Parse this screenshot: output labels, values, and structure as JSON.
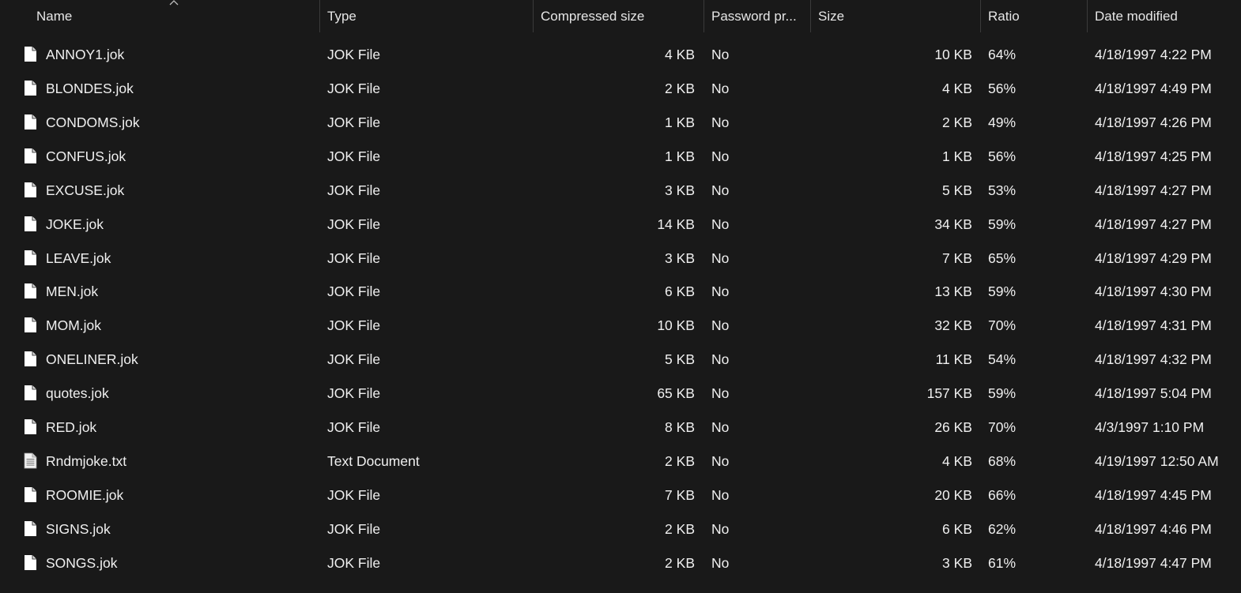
{
  "columns": {
    "name": "Name",
    "type": "Type",
    "compressed_size": "Compressed size",
    "password_protected": "Password pr...",
    "size": "Size",
    "ratio": "Ratio",
    "date_modified": "Date modified"
  },
  "sort": {
    "column": "Name",
    "direction": "ascending",
    "icon": "sort-ascending-caret-icon"
  },
  "rows": [
    {
      "icon": "document-icon",
      "name": "ANNOY1.jok",
      "type": "JOK File",
      "compressed": "4 KB",
      "password": "No",
      "size": "10 KB",
      "ratio": "64%",
      "date": "4/18/1997 4:22 PM"
    },
    {
      "icon": "document-icon",
      "name": "BLONDES.jok",
      "type": "JOK File",
      "compressed": "2 KB",
      "password": "No",
      "size": "4 KB",
      "ratio": "56%",
      "date": "4/18/1997 4:49 PM"
    },
    {
      "icon": "document-icon",
      "name": "CONDOMS.jok",
      "type": "JOK File",
      "compressed": "1 KB",
      "password": "No",
      "size": "2 KB",
      "ratio": "49%",
      "date": "4/18/1997 4:26 PM"
    },
    {
      "icon": "document-icon",
      "name": "CONFUS.jok",
      "type": "JOK File",
      "compressed": "1 KB",
      "password": "No",
      "size": "1 KB",
      "ratio": "56%",
      "date": "4/18/1997 4:25 PM"
    },
    {
      "icon": "document-icon",
      "name": "EXCUSE.jok",
      "type": "JOK File",
      "compressed": "3 KB",
      "password": "No",
      "size": "5 KB",
      "ratio": "53%",
      "date": "4/18/1997 4:27 PM"
    },
    {
      "icon": "document-icon",
      "name": "JOKE.jok",
      "type": "JOK File",
      "compressed": "14 KB",
      "password": "No",
      "size": "34 KB",
      "ratio": "59%",
      "date": "4/18/1997 4:27 PM"
    },
    {
      "icon": "document-icon",
      "name": "LEAVE.jok",
      "type": "JOK File",
      "compressed": "3 KB",
      "password": "No",
      "size": "7 KB",
      "ratio": "65%",
      "date": "4/18/1997 4:29 PM"
    },
    {
      "icon": "document-icon",
      "name": "MEN.jok",
      "type": "JOK File",
      "compressed": "6 KB",
      "password": "No",
      "size": "13 KB",
      "ratio": "59%",
      "date": "4/18/1997 4:30 PM"
    },
    {
      "icon": "document-icon",
      "name": "MOM.jok",
      "type": "JOK File",
      "compressed": "10 KB",
      "password": "No",
      "size": "32 KB",
      "ratio": "70%",
      "date": "4/18/1997 4:31 PM"
    },
    {
      "icon": "document-icon",
      "name": "ONELINER.jok",
      "type": "JOK File",
      "compressed": "5 KB",
      "password": "No",
      "size": "11 KB",
      "ratio": "54%",
      "date": "4/18/1997 4:32 PM"
    },
    {
      "icon": "document-icon",
      "name": "quotes.jok",
      "type": "JOK File",
      "compressed": "65 KB",
      "password": "No",
      "size": "157 KB",
      "ratio": "59%",
      "date": "4/18/1997 5:04 PM"
    },
    {
      "icon": "document-icon",
      "name": "RED.jok",
      "type": "JOK File",
      "compressed": "8 KB",
      "password": "No",
      "size": "26 KB",
      "ratio": "70%",
      "date": "4/3/1997 1:10 PM"
    },
    {
      "icon": "text-document-icon",
      "name": "Rndmjoke.txt",
      "type": "Text Document",
      "compressed": "2 KB",
      "password": "No",
      "size": "4 KB",
      "ratio": "68%",
      "date": "4/19/1997 12:50 AM"
    },
    {
      "icon": "document-icon",
      "name": "ROOMIE.jok",
      "type": "JOK File",
      "compressed": "7 KB",
      "password": "No",
      "size": "20 KB",
      "ratio": "66%",
      "date": "4/18/1997 4:45 PM"
    },
    {
      "icon": "document-icon",
      "name": "SIGNS.jok",
      "type": "JOK File",
      "compressed": "2 KB",
      "password": "No",
      "size": "6 KB",
      "ratio": "62%",
      "date": "4/18/1997 4:46 PM"
    },
    {
      "icon": "document-icon",
      "name": "SONGS.jok",
      "type": "JOK File",
      "compressed": "2 KB",
      "password": "No",
      "size": "3 KB",
      "ratio": "61%",
      "date": "4/18/1997 4:47 PM"
    }
  ],
  "colors": {
    "background": "#191919",
    "text": "#f0f0f0",
    "separator": "#3a3a3a"
  }
}
